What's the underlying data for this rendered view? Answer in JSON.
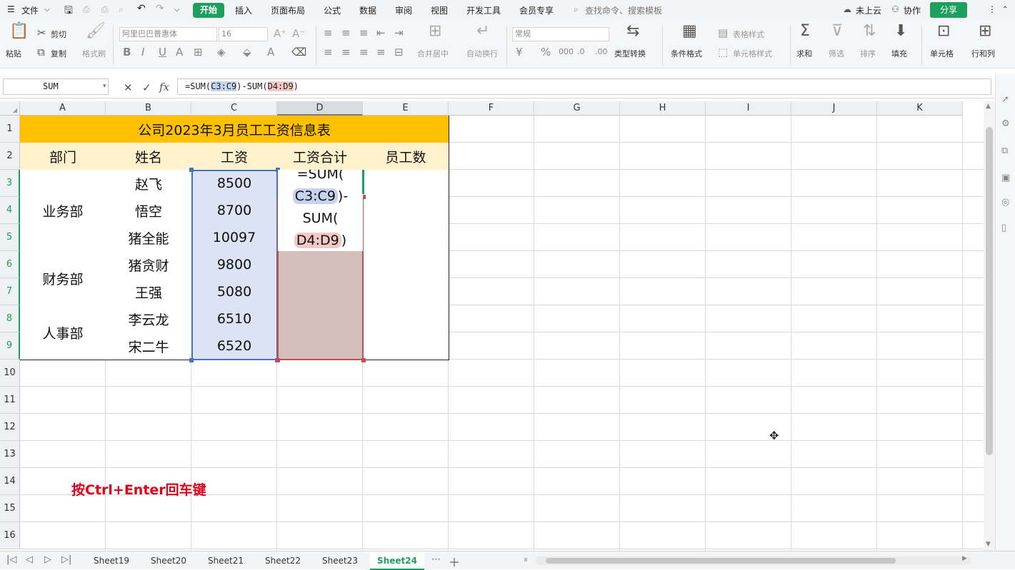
{
  "menubar": {
    "file": "文件",
    "tabs": [
      "开始",
      "插入",
      "页面布局",
      "公式",
      "数据",
      "审阅",
      "视图",
      "开发工具",
      "会员专享"
    ],
    "search_placeholder": "查找命令、搜索模板",
    "cloud": "未上云",
    "collab": "协作",
    "share": "分享"
  },
  "toolbar": {
    "paste": "粘贴",
    "cut": "剪切",
    "copy": "复制",
    "format_painter": "格式刷",
    "font_name": "阿里巴巴普惠体",
    "font_size": "16",
    "merge_center": "合并居中",
    "wrap_text": "自动换行",
    "number_format": "常规",
    "type_convert": "类型转换",
    "conditional_format": "条件格式",
    "table_style": "表格样式",
    "cell_style": "单元格样式",
    "sum": "求和",
    "filter": "筛选",
    "sort": "排序",
    "fill": "填充",
    "cell": "单元格",
    "row_col": "行和列"
  },
  "formula_bar": {
    "name_box": "SUM",
    "formula_prefix": "=SUM(",
    "range1": "C3:C9",
    "formula_mid": ")-SUM(",
    "range2": "D4:D9",
    "formula_suffix": ")"
  },
  "columns": [
    "A",
    "B",
    "C",
    "D",
    "E",
    "F",
    "G",
    "H",
    "I",
    "J",
    "K"
  ],
  "rows": [
    "1",
    "2",
    "3",
    "4",
    "5",
    "6",
    "7",
    "8",
    "9",
    "10",
    "11",
    "12",
    "13",
    "14",
    "15",
    "16"
  ],
  "sheet": {
    "title": "公司2023年3月员工工资信息表",
    "headers": [
      "部门",
      "姓名",
      "工资",
      "工资合计",
      "员工数"
    ],
    "departments": [
      "业务部",
      "财务部",
      "人事部"
    ],
    "names": [
      "赵飞",
      "悟空",
      "猪全能",
      "猪贪财",
      "王强",
      "李云龙",
      "宋二牛"
    ],
    "salaries": [
      "8500",
      "8700",
      "10097",
      "9800",
      "5080",
      "6510",
      "6520"
    ],
    "editor": {
      "line1": "=SUM(",
      "range1": "C3:C9",
      "line2_suffix": ")-",
      "line3": "SUM(",
      "range2": "D4:D9",
      "line4_suffix": ")"
    }
  },
  "note": "按Ctrl+Enter回车键",
  "sheet_tabs": [
    "Sheet19",
    "Sheet20",
    "Sheet21",
    "Sheet22",
    "Sheet23",
    "Sheet24"
  ],
  "active_sheet": "Sheet24",
  "colors": {
    "accent": "#1f9f5e",
    "title_fill": "#ffc000",
    "header_fill": "#fff2cc",
    "range1": "#4472c4",
    "range2": "#c0504d",
    "note": "#e0001b"
  }
}
